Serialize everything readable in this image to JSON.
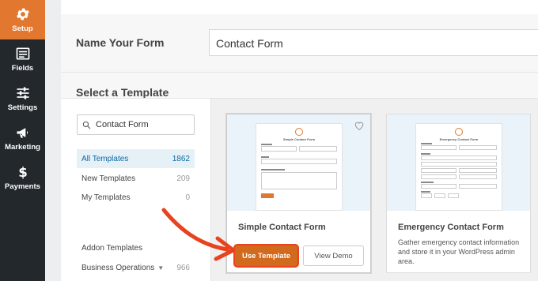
{
  "sidebar": {
    "items": [
      {
        "label": "Setup",
        "icon": "gear-icon",
        "active": true
      },
      {
        "label": "Fields",
        "icon": "fields-list-icon",
        "active": false
      },
      {
        "label": "Settings",
        "icon": "sliders-icon",
        "active": false
      },
      {
        "label": "Marketing",
        "icon": "megaphone-icon",
        "active": false
      },
      {
        "label": "Payments",
        "icon": "dollar-icon",
        "active": false
      }
    ]
  },
  "form_name": {
    "label": "Name Your Form",
    "value": "Contact Form"
  },
  "templates": {
    "heading": "Select a Template",
    "search_value": "Contact Form",
    "categories": [
      {
        "label": "All Templates",
        "count": "1862",
        "active": true
      },
      {
        "label": "New Templates",
        "count": "209",
        "active": false
      },
      {
        "label": "My Templates",
        "count": "0",
        "active": false
      },
      {
        "label": "Addon Templates",
        "count": "",
        "active": false
      },
      {
        "label": "Business Operations",
        "count": "966",
        "active": false
      }
    ],
    "cards": [
      {
        "title": "Simple Contact Form",
        "preview_title": "Simple Contact Form",
        "use_label": "Use Template",
        "demo_label": "View Demo"
      },
      {
        "title": "Emergency Contact Form",
        "preview_title": "Emergency Contact Form",
        "description": "Gather emergency contact information and store it in your WordPress admin area."
      }
    ]
  },
  "colors": {
    "accent": "#e27730",
    "sidebar_bg": "#23282d",
    "active_category": "#0b69a3",
    "annotation_arrow": "#e8421f"
  }
}
